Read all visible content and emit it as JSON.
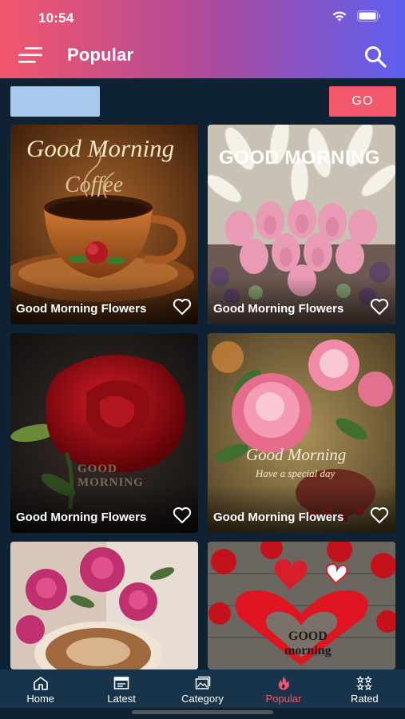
{
  "status_bar": {
    "time": "10:54",
    "icons": [
      "wifi-icon",
      "battery-icon"
    ]
  },
  "header": {
    "title": "Popular",
    "menu_icon": "hamburger-icon",
    "search_icon": "search-icon"
  },
  "search": {
    "value": "",
    "placeholder": "",
    "go_label": "GO"
  },
  "grid": {
    "items": [
      {
        "caption": "Good Morning Flowers",
        "overlay_lines": [
          "Good Morning",
          "Coffee"
        ]
      },
      {
        "caption": "Good Morning Flowers",
        "overlay_lines": [
          "GOOD MORNING"
        ]
      },
      {
        "caption": "Good Morning Flowers",
        "overlay_lines": [
          "GOOD",
          "MORNING"
        ]
      },
      {
        "caption": "Good Morning Flowers",
        "overlay_lines": [
          "Good Morning",
          "Have a special day"
        ]
      },
      {
        "caption": "",
        "overlay_lines": []
      },
      {
        "caption": "",
        "overlay_lines": [
          "GOOD",
          "morning"
        ]
      }
    ]
  },
  "bottom_nav": {
    "items": [
      {
        "label": "Home",
        "icon": "home-icon",
        "active": false
      },
      {
        "label": "Latest",
        "icon": "calendar-icon",
        "active": false
      },
      {
        "label": "Category",
        "icon": "gallery-icon",
        "active": false
      },
      {
        "label": "Popular",
        "icon": "fire-icon",
        "active": true
      },
      {
        "label": "Rated",
        "icon": "stars-icon",
        "active": false
      }
    ]
  },
  "colors": {
    "accent": "#f2576c",
    "gradient_start": "#f2576c",
    "gradient_end": "#5e5ff0",
    "background": "#0e2233",
    "nav_background": "#17344b"
  }
}
